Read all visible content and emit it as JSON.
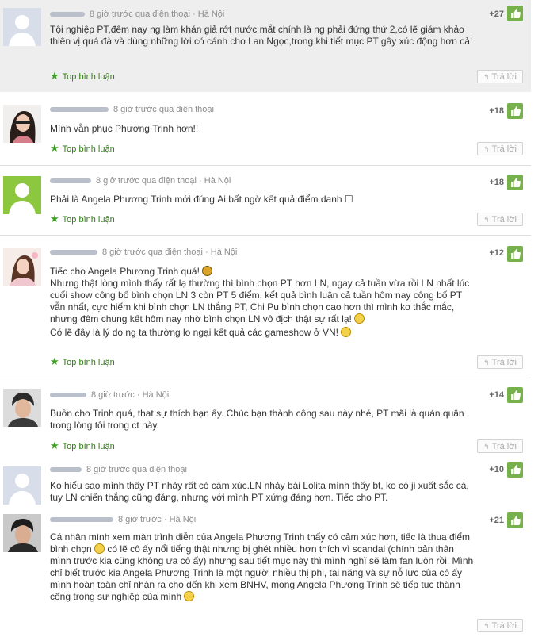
{
  "ui": {
    "top_label": "Top bình luận",
    "reply_label": "Trả lời"
  },
  "comments": [
    {
      "meta": "8 giờ trước qua điện thoại · Hà Nội",
      "score": "+27",
      "text": "Tội nghiệp PT,đêm nay ng làm khán giả rớt nước mắt chính là ng phải đứng thứ 2,có lẽ giám khảo thiên vị quá đà và dùng những lời có cánh cho Lan Ngọc,trong khi tiết mục PT gây xúc động hơn cả!"
    },
    {
      "meta": "8 giờ trước qua điện thoại",
      "score": "+18",
      "text": "Mình vẫn phục Phương Trinh hơn!!"
    },
    {
      "meta": "8 giờ trước qua điện thoại · Hà Nội",
      "score": "+18",
      "text": "Phải là Angela Phương Trinh mới đúng.Ai bất ngờ kết quả điểm danh ☐"
    },
    {
      "meta": "8 giờ trước qua điện thoại · Hà Nội",
      "score": "+12",
      "line1": "Tiếc cho Angela Phương Trinh quá!",
      "line2": "Nhưng thật lòng mình thấy rất lạ thường thì bình chọn PT hơn LN, ngay cả tuần vừa rồi LN nhất lúc cuối show công bố bình chọn LN 3 còn PT 5 điểm, kết quả bình luận cả tuần hôm nay công bố PT vẫn nhất, cực hiếm khi bình chọn LN thắng PT, Chi Pu bình chọn cao hơn thì mình ko thắc mắc, nhưng đêm chung kết hôm nay nhờ bình chọn LN vô địch thật sự rất lạ!",
      "line3": "Có lẽ đây là lý do ng ta thường lo ngại kết quả các gameshow ở VN!"
    },
    {
      "meta": "8 giờ trước · Hà Nội",
      "score": "+14",
      "text": "Buồn cho Trinh quá, that sự thích bạn ấy. Chúc bạn thành công sau này nhé, PT mãi là quán quân trong lòng tôi trong ct này."
    },
    {
      "meta": "8 giờ trước qua điện thoại",
      "score": "+10",
      "text": "Ko hiểu sao mình thấy PT nhảy rất có cảm xúc.LN nhảy bài Lolita mình thấy bt, ko có ji xuất sắc cả, tuy LN chiến thắng cũng đáng, nhưng với mình PT xứng đáng hơn. Tiếc cho PT."
    },
    {
      "meta": "8 giờ trước · Hà Nội",
      "score": "+21",
      "p1": "Cá nhân mình xem màn trình diễn của Angela Phương Trinh thấy có cảm xúc hơn, tiếc là thua điểm bình chọn",
      "p2": "có lẽ cô ấy nổi tiếng thật nhưng bị ghét nhiều hơn thích vì scandal (chính bản thân mình trước kia cũng không ưa cô ấy) nhưng sau tiết mục này thì mình nghĩ sẽ làm fan luôn rồi. Mình chỉ biết trước kia Angela Phương Trinh là một người nhiều thị phi, tài năng và sự nỗ lực của cô ấy mình hoàn toàn chỉ nhận ra cho đến khi xem BNHV, mong Angela Phương Trinh sẽ tiếp tục thành công trong sự nghiệp của mình"
    }
  ],
  "colors": {
    "like_button": "#76b14b",
    "top_label": "#2f7d14",
    "shaded_bg": "#eeeeee"
  },
  "icons": [
    "thumbs-up-icon",
    "star-icon",
    "reply-icon",
    "default-avatar-icon",
    "smiley-icon"
  ]
}
